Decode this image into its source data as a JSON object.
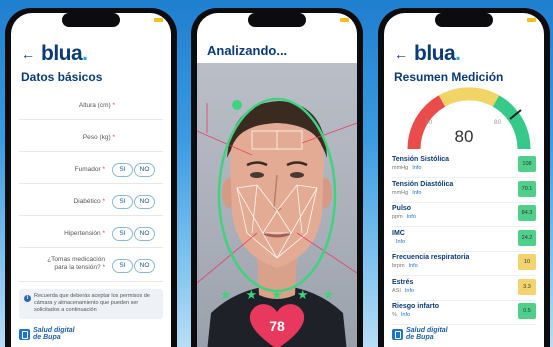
{
  "colors": {
    "brand_navy": "#0a3a7a",
    "accent_blue": "#2aa6df",
    "face_mesh_green": "#3fd27f",
    "heart_pink": "#e8385e",
    "battery": "#f3c01c"
  },
  "brand": {
    "logo_text": "blua",
    "logo_dot": ".",
    "bupa_line1": "Salud digital",
    "bupa_line2": "de Bupa"
  },
  "phone1": {
    "title": "Datos básicos",
    "fields": [
      {
        "label": "Altura (cm)",
        "req": "*"
      },
      {
        "label": "Peso (kg)",
        "req": "*"
      }
    ],
    "yesno": [
      {
        "label": "Fumador",
        "req": "*",
        "si": "SI",
        "no": "NO"
      },
      {
        "label": "Diabético",
        "req": "*",
        "si": "SI",
        "no": "NO"
      },
      {
        "label": "Hipertensión",
        "req": "*",
        "si": "SI",
        "no": "NO"
      },
      {
        "label": "¿Tomas medicación para la tensión?",
        "req": "*",
        "si": "SI",
        "no": "NO"
      }
    ],
    "notice": "Recuerda que deberás aceptar los permisos de cámara y almacenamiento que pueden ser solicitados a continuación"
  },
  "phone2": {
    "title": "Analizando...",
    "heart_value": "78",
    "stars_count": 5
  },
  "phone3": {
    "title": "Resumen Medición",
    "gauge": {
      "value": "80",
      "tick_left": "20",
      "tick_right": "80"
    },
    "metrics": [
      {
        "name": "Tensión Sistólica",
        "unit": "mmHg",
        "info": "Info",
        "value": "108",
        "status_color": "#4fd08a"
      },
      {
        "name": "Tensión Diastólica",
        "unit": "mmHg",
        "info": "Info",
        "value": "70.1",
        "status_color": "#4fd08a"
      },
      {
        "name": "Pulso",
        "unit": "ppm",
        "info": "Info",
        "value": "84.3",
        "status_color": "#4fd08a"
      },
      {
        "name": "IMC",
        "unit": "",
        "info": "Info",
        "value": "24.2",
        "status_color": "#4fd08a"
      },
      {
        "name": "Frecuencia respiratoria",
        "unit": "brpm",
        "info": "Info",
        "value": "10",
        "status_color": "#f3d36e"
      },
      {
        "name": "Estrés",
        "unit": "ASI",
        "info": "Info",
        "value": "3.3",
        "status_color": "#f3d36e"
      },
      {
        "name": "Riesgo infarto",
        "unit": "%",
        "info": "Info",
        "value": "0.5",
        "status_color": "#4fd08a"
      }
    ]
  }
}
